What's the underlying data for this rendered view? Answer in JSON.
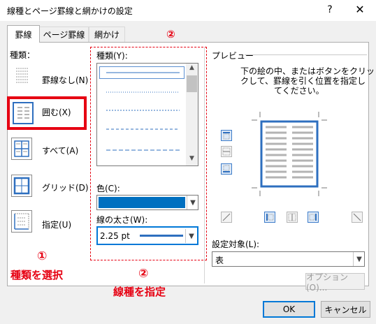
{
  "window": {
    "title": "線種とページ罫線と網かけの設定",
    "help": "?",
    "close": "✕"
  },
  "tabs": [
    {
      "label": "罫線",
      "active": true
    },
    {
      "label": "ページ罫線",
      "active": false
    },
    {
      "label": "網かけ",
      "active": false
    }
  ],
  "setting": {
    "heading": "種類：",
    "options": [
      {
        "label": "罫線なし(N)",
        "selected": false
      },
      {
        "label": "囲む(X)",
        "selected": true
      },
      {
        "label": "すべて(A)",
        "selected": false
      },
      {
        "label": "グリッド(D)",
        "selected": false
      },
      {
        "label": "指定(U)",
        "selected": false
      }
    ]
  },
  "style": {
    "heading": "種類(Y):",
    "color_label": "色(C):",
    "color_value": "#0070c0",
    "width_label": "線の太さ(W):",
    "width_value": "2.25 pt"
  },
  "preview": {
    "heading": "プレビュー",
    "instruction_lines": [
      "下の絵の中、またはボタンをクリッ",
      "クして、罫線を引く位置を指定し",
      "てください。"
    ],
    "apply_label": "設定対象(L):",
    "apply_value": "表",
    "options_button": "オプション(O)..."
  },
  "annotations": {
    "circle1": "①",
    "text1": "種類を選択",
    "circle2_top": "②",
    "circle2_bottom": "②",
    "text2": "線種を指定"
  },
  "buttons": {
    "ok": "OK",
    "cancel": "キャンセル"
  },
  "colors": {
    "accent_red": "#e60012",
    "border_blue": "#0070c0"
  }
}
